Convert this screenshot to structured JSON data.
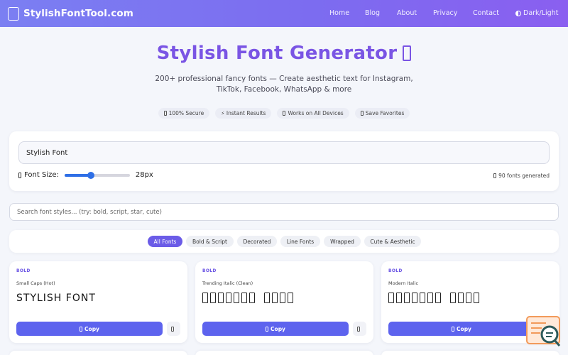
{
  "header": {
    "logo_text": "StylishFontTool.com",
    "nav": {
      "home": "Home",
      "blog": "Blog",
      "about": "About",
      "privacy": "Privacy",
      "contact": "Contact",
      "theme": "Dark/Light"
    }
  },
  "hero": {
    "title": "Stylish Font Generator",
    "subtitle": "200+ professional fancy fonts — Create aesthetic text for Instagram, TikTok, Facebook, WhatsApp & more",
    "features": [
      "100% Secure",
      "⚡ Instant Results",
      "Works on All Devices",
      "Save Favorites"
    ]
  },
  "editor": {
    "input_value": "Stylish Font",
    "font_size_label": "Font Size:",
    "font_size_value": "28px",
    "font_size_fraction": 0.4,
    "generated_count": "90 fonts generated"
  },
  "search": {
    "placeholder": "Search font styles... (try: bold, script, star, cute)"
  },
  "filters": {
    "items": [
      "All Fonts",
      "Bold & Script",
      "Decorated",
      "Line Fonts",
      "Wrapped",
      "Cute & Aesthetic"
    ],
    "active": "All Fonts"
  },
  "cards": [
    {
      "badge": "BOLD",
      "name": "Small Caps (Hot)",
      "sample": "STYLISH FONT",
      "copy_label": "Copy"
    },
    {
      "badge": "BOLD",
      "name": "Trending Italic (Clean)",
      "sample": "",
      "copy_label": "Copy"
    },
    {
      "badge": "BOLD",
      "name": "Modern Italic",
      "sample": "",
      "copy_label": "Copy"
    }
  ],
  "colors": {
    "brand_gradient_start": "#7b7ff2",
    "brand_gradient_end": "#8a5ff0",
    "title_purple": "#7a55e4",
    "copy_button": "#5d63ee",
    "slider": "#2f6fe6",
    "active_filter": "#6b5ce7"
  },
  "icons": {
    "logo": "logo-box-icon",
    "theme": "half-circle-icon",
    "floating": "search-lines-icon"
  }
}
